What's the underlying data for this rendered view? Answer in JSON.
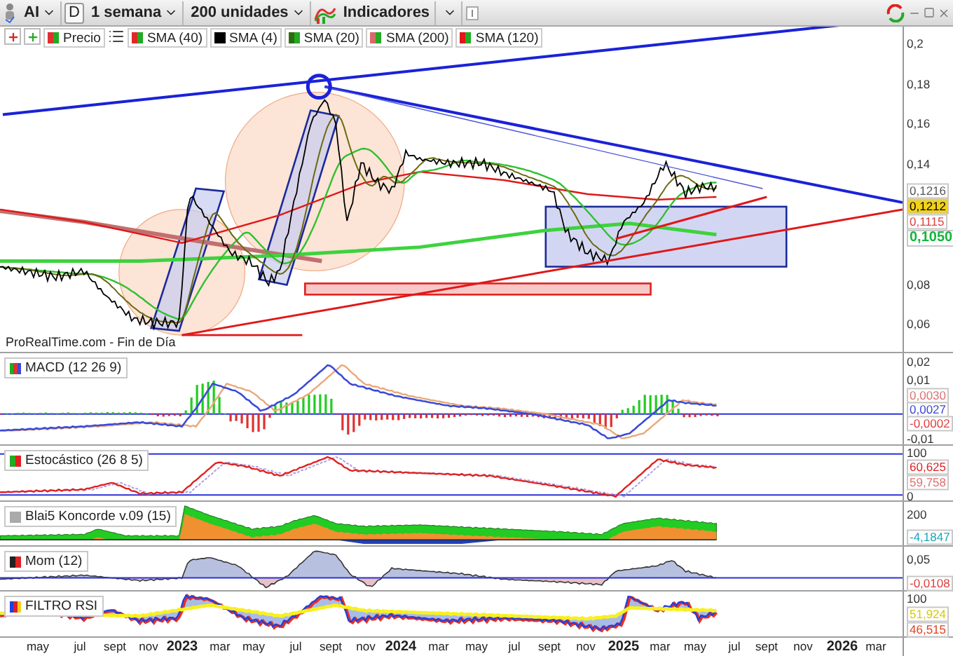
{
  "toolbar": {
    "symbol": "AI",
    "period_code": "D",
    "interval": "1 semana",
    "units": "200 unidades",
    "indicators_label": "Indicadores"
  },
  "legend": [
    {
      "label": "Precio",
      "color": "#e03030"
    },
    {
      "label": "SMA (40)",
      "color": "#e02828"
    },
    {
      "label": "SMA (4)",
      "color": "#000000"
    },
    {
      "label": "SMA (20)",
      "color": "#2e6b12"
    },
    {
      "label": "SMA (200)",
      "color": "#d86a6a"
    },
    {
      "label": "SMA (120)",
      "color": "#e01818"
    }
  ],
  "panels": [
    {
      "kind": "price",
      "footer": "ProRealTime.com - Fin de Día",
      "axis_labels": [
        {
          "text": "0,2",
          "kind": "tick"
        },
        {
          "text": "0,18",
          "kind": "tick"
        },
        {
          "text": "0,16",
          "kind": "tick"
        },
        {
          "text": "0,14",
          "kind": "tick"
        },
        {
          "text": "0,1216",
          "kind": "tag",
          "color": "#555555"
        },
        {
          "text": "0,1212",
          "kind": "tag",
          "color": "#f2d21a"
        },
        {
          "text": "0,1115",
          "kind": "tag",
          "color": "#e04040"
        },
        {
          "text": "0,1050",
          "kind": "tag",
          "color": "#14b43c"
        },
        {
          "text": "0,08",
          "kind": "tick"
        },
        {
          "text": "0,06",
          "kind": "tick"
        }
      ]
    },
    {
      "kind": "macd",
      "title": "MACD (12 26 9)",
      "axis_labels": [
        {
          "text": "0,02",
          "kind": "tick"
        },
        {
          "text": "0,01",
          "kind": "tick"
        },
        {
          "text": "0,0030",
          "kind": "tag",
          "color": "#e07070"
        },
        {
          "text": "0,0027",
          "kind": "tag",
          "color": "#3a4ad8"
        },
        {
          "text": "-0,0002",
          "kind": "tag",
          "color": "#e04040"
        },
        {
          "text": "-0,01",
          "kind": "tick"
        }
      ]
    },
    {
      "kind": "stochastic",
      "title": "Estocástico (26 8 5)",
      "axis_labels": [
        {
          "text": "100",
          "kind": "tick"
        },
        {
          "text": "60,625",
          "kind": "tag",
          "color": "#e02020"
        },
        {
          "text": "59,758",
          "kind": "tag",
          "color": "#e07070"
        },
        {
          "text": "0",
          "kind": "tick"
        }
      ]
    },
    {
      "kind": "koncorde",
      "title": "Blai5 Koncorde v.09 (15)",
      "axis_labels": [
        {
          "text": "200",
          "kind": "tick"
        },
        {
          "text": "-4,1847",
          "kind": "tag",
          "color": "#1aa8b8"
        }
      ]
    },
    {
      "kind": "momentum",
      "title": "Mom (12)",
      "axis_labels": [
        {
          "text": "0,05",
          "kind": "tick"
        },
        {
          "text": "-0,0108",
          "kind": "tag",
          "color": "#e04040"
        }
      ]
    },
    {
      "kind": "rsi",
      "title": "FILTRO RSI",
      "axis_labels": [
        {
          "text": "100",
          "kind": "tick"
        },
        {
          "text": "51,924",
          "kind": "tag",
          "color": "#d8c800"
        },
        {
          "text": "46,515",
          "kind": "tag",
          "color": "#e04020"
        }
      ]
    }
  ],
  "time_axis": [
    {
      "label": "may",
      "kind": "month"
    },
    {
      "label": "jul",
      "kind": "month"
    },
    {
      "label": "sept",
      "kind": "month"
    },
    {
      "label": "nov",
      "kind": "month"
    },
    {
      "label": "2023",
      "kind": "year"
    },
    {
      "label": "mar",
      "kind": "month"
    },
    {
      "label": "may",
      "kind": "month"
    },
    {
      "label": "jul",
      "kind": "month"
    },
    {
      "label": "sept",
      "kind": "month"
    },
    {
      "label": "nov",
      "kind": "month"
    },
    {
      "label": "2024",
      "kind": "year"
    },
    {
      "label": "mar",
      "kind": "month"
    },
    {
      "label": "may",
      "kind": "month"
    },
    {
      "label": "jul",
      "kind": "month"
    },
    {
      "label": "sept",
      "kind": "month"
    },
    {
      "label": "nov",
      "kind": "month"
    },
    {
      "label": "2025",
      "kind": "year"
    },
    {
      "label": "mar",
      "kind": "month"
    },
    {
      "label": "may",
      "kind": "month"
    },
    {
      "label": "jul",
      "kind": "month"
    },
    {
      "label": "sept",
      "kind": "month"
    },
    {
      "label": "nov",
      "kind": "month"
    },
    {
      "label": "2026",
      "kind": "year"
    },
    {
      "label": "mar",
      "kind": "month"
    }
  ]
}
